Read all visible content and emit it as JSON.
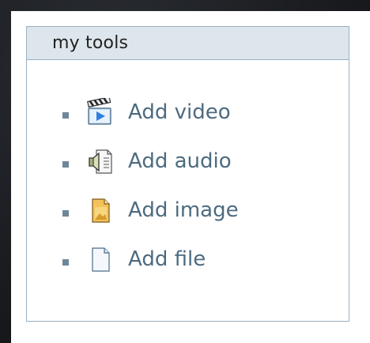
{
  "panel": {
    "title": "my tools",
    "items": [
      {
        "label": "Add video",
        "icon": "video-clapper-icon"
      },
      {
        "label": "Add audio",
        "icon": "audio-speaker-icon"
      },
      {
        "label": "Add image",
        "icon": "image-document-icon"
      },
      {
        "label": "Add file",
        "icon": "file-document-icon"
      }
    ]
  },
  "colors": {
    "link": "#4d6b80",
    "header_bg": "#dde6ec",
    "border": "#9bb0c0",
    "bullet": "#6e8798"
  }
}
